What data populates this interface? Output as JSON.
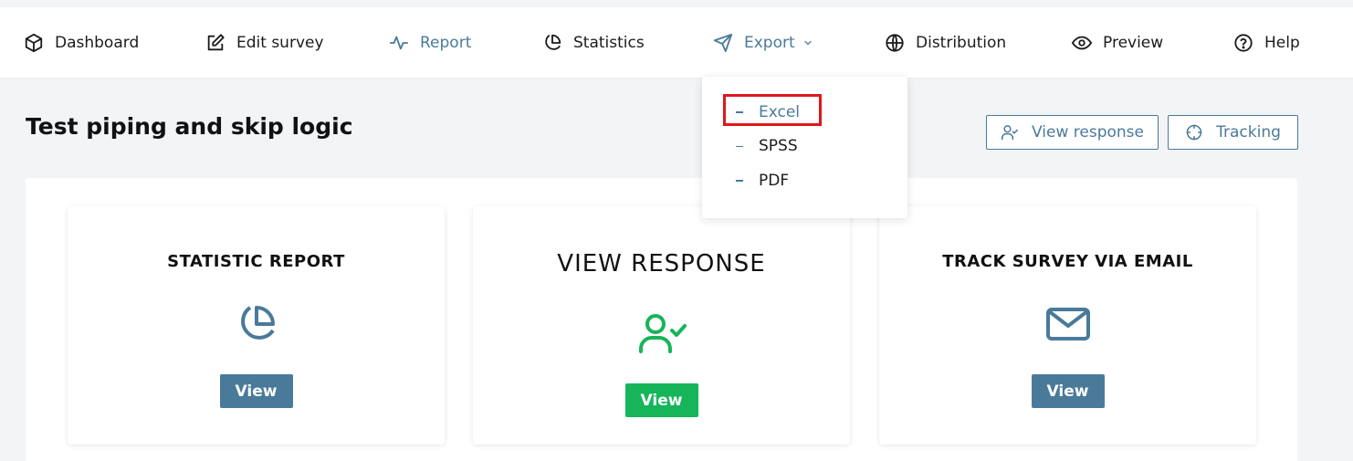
{
  "nav": {
    "items": [
      {
        "label": "Dashboard",
        "icon": "cube-icon"
      },
      {
        "label": "Edit survey",
        "icon": "edit-icon"
      },
      {
        "label": "Report",
        "icon": "activity-icon"
      },
      {
        "label": "Statistics",
        "icon": "pie-chart-icon"
      },
      {
        "label": "Export",
        "icon": "send-icon"
      },
      {
        "label": "Distribution",
        "icon": "globe-icon"
      },
      {
        "label": "Preview",
        "icon": "eye-icon"
      },
      {
        "label": "Help",
        "icon": "help-circle-icon"
      }
    ],
    "active": "Report"
  },
  "export_menu": {
    "items": [
      "Excel",
      "SPSS",
      "PDF"
    ],
    "selected": "Excel"
  },
  "page": {
    "title": "Test piping and skip logic",
    "view_response_label": "View response",
    "tracking_label": "Tracking"
  },
  "cards": [
    {
      "title": "STATISTIC REPORT",
      "icon": "pie-chart-icon",
      "button": "View"
    },
    {
      "title": "VIEW RESPONSE",
      "icon": "user-check-icon",
      "button": "View"
    },
    {
      "title": "TRACK SURVEY VIA EMAIL",
      "icon": "mail-icon",
      "button": "View"
    }
  ],
  "colors": {
    "accent": "#4a7a9a",
    "green": "#16b55a",
    "highlight": "#e0161d",
    "background": "#f3f4f6"
  }
}
